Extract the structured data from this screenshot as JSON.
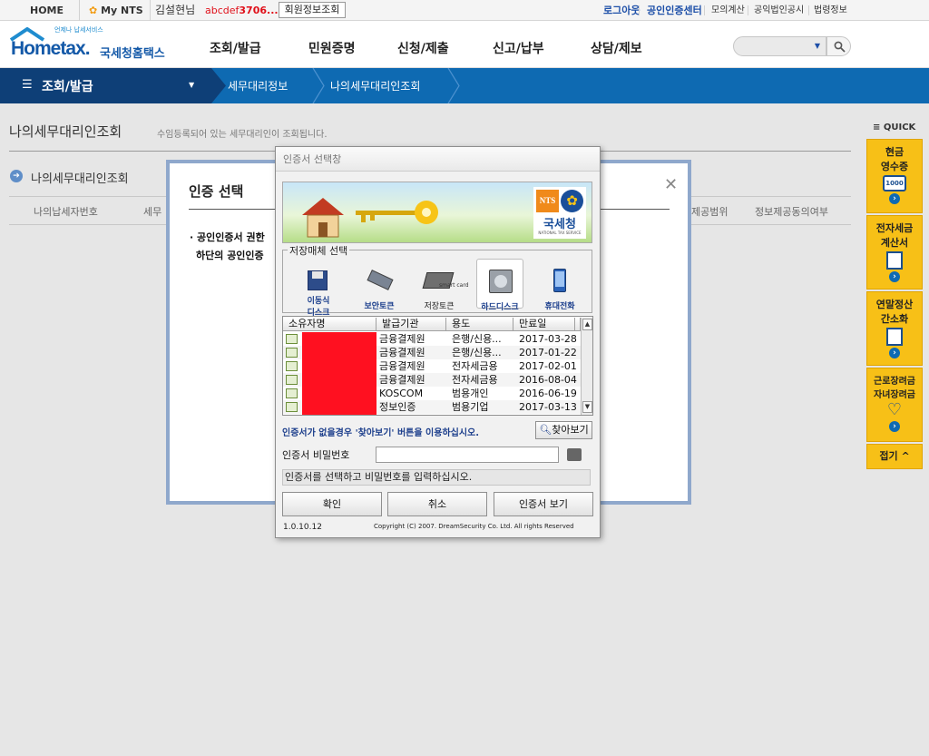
{
  "topbar": {
    "home": "HOME",
    "mynts": "My NTS",
    "user_name": "김설현님",
    "user_id": "abcdef",
    "user_id_tail": "3706...",
    "member_info_btn": "회원정보조회",
    "links": [
      "로그아웃",
      "공인인증센터",
      "모의계산",
      "공익법인공시",
      "법령정보"
    ]
  },
  "header": {
    "logo_small": "언제나 납세서비스",
    "logo_main": "Hometax.",
    "logo_kr": "국세청홈택스",
    "gnb": [
      "조회/발급",
      "민원증명",
      "신청/제출",
      "신고/납부",
      "상담/제보"
    ],
    "search_placeholder": ""
  },
  "navbar": {
    "menu": "조회/발급",
    "crumbs": [
      "세무대리정보",
      "나의세무대리인조회"
    ]
  },
  "page": {
    "title": "나의세무대리인조회",
    "subtitle": "수임등록되어 있는 세무대리인이 조회됩니다.",
    "section": "나의세무대리인조회",
    "col_left": [
      "나의납세자번호",
      "세무"
    ],
    "col_right": [
      "제공범위",
      "정보제공동의여부"
    ]
  },
  "quick": {
    "header": "QUICK",
    "items": [
      {
        "l1": "현금",
        "l2": "영수증",
        "icon": "receipt-icon"
      },
      {
        "l1": "전자세금",
        "l2": "계산서",
        "icon": "invoice-icon"
      },
      {
        "l1": "연말정산",
        "l2": "간소화",
        "icon": "calculator-icon"
      },
      {
        "l1": "근로장려금",
        "l2": "자녀장려금",
        "icon": "heart-icon"
      }
    ],
    "collapse": "접기"
  },
  "auth_modal": {
    "title": "인증 선택",
    "line1": "공인인증서 권한",
    "line2": "하단의 공인인증"
  },
  "cert_dialog": {
    "title": "인증서 선택창",
    "banner_logo_en": "NTS",
    "banner_logo_kr": "국세청",
    "banner_logo_sub": "NATIONAL TAX SERVICE",
    "media_legend": "저장매체 선택",
    "media": [
      {
        "label1": "이동식",
        "label2": "디스크",
        "icon": "removable-disk-icon"
      },
      {
        "label1": "보안토큰",
        "label2": "",
        "icon": "security-token-icon"
      },
      {
        "label1": "저장토큰",
        "label2": "",
        "icon": "smart-card-icon"
      },
      {
        "label1": "하드디스크",
        "label2": "",
        "icon": "hard-disk-icon"
      },
      {
        "label1": "휴대전화",
        "label2": "",
        "icon": "mobile-phone-icon"
      }
    ],
    "smart_label": "smart card",
    "columns": [
      "소유자명",
      "발급기관",
      "용도",
      "만료일"
    ],
    "rows": [
      {
        "issuer": "금융결제원",
        "usage": "은행/신용...",
        "expiry": "2017-03-28"
      },
      {
        "issuer": "금융결제원",
        "usage": "은행/신용...",
        "expiry": "2017-01-22"
      },
      {
        "issuer": "금융결제원",
        "usage": "전자세금용",
        "expiry": "2017-02-01"
      },
      {
        "issuer": "금융결제원",
        "usage": "전자세금용",
        "expiry": "2016-08-04"
      },
      {
        "issuer": "KOSCOM",
        "usage": "범용개인",
        "expiry": "2016-06-19"
      },
      {
        "issuer": "정보인증",
        "usage": "범용기업",
        "expiry": "2017-03-13"
      }
    ],
    "notice": "인증서가 없을경우 '찾아보기' 버튼을 이용하십시오.",
    "browse_btn": "찾아보기",
    "password_label": "인증서 비밀번호",
    "status": "인증서를 선택하고 비밀번호를 입력하십시오.",
    "ok_btn": "확인",
    "cancel_btn": "취소",
    "view_btn": "인증서 보기",
    "version": "1.0.10.12",
    "copyright": "Copyright (C) 2007. DreamSecurity Co. Ltd. All rights Reserved"
  },
  "colors": {
    "nav_dark": "#0e3f77",
    "nav_blue": "#0e6ab2",
    "quick_yellow": "#f7c017",
    "redact_red": "#ff1020",
    "link_blue": "#1d4fa8"
  }
}
